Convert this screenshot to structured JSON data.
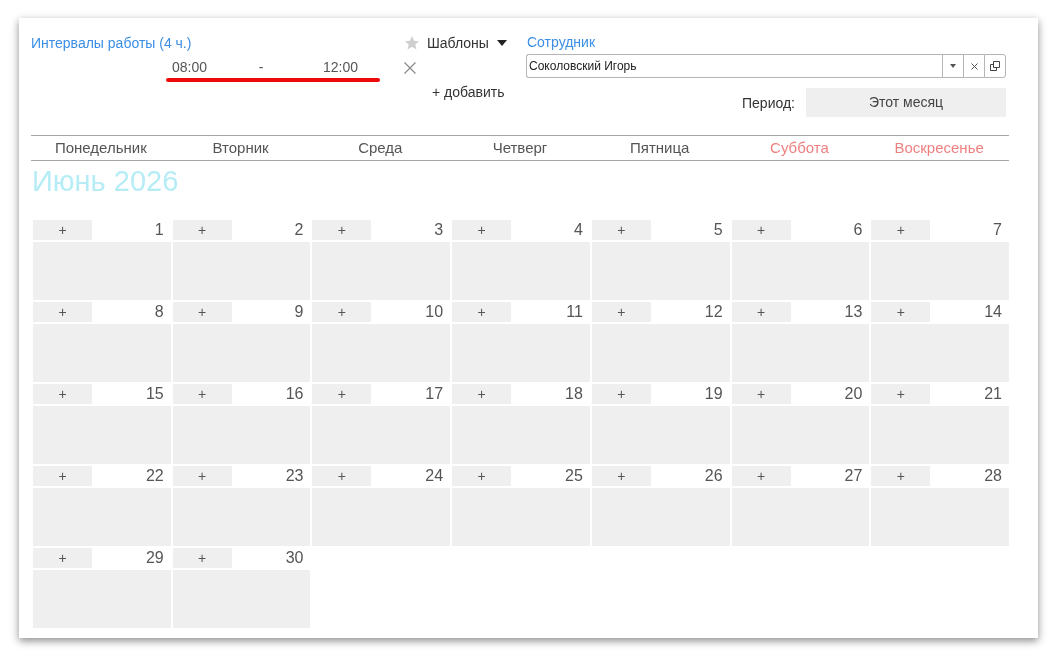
{
  "intervals": {
    "title": "Интервалы работы (4 ч.)",
    "items": [
      {
        "start": "08:00",
        "separator": "-",
        "end": "12:00",
        "highlighted": true
      }
    ],
    "add_label": "+ добавить"
  },
  "templates": {
    "label": "Шаблоны"
  },
  "employee": {
    "label": "Сотрудник",
    "value": "Соколовский Игорь"
  },
  "period": {
    "label": "Период:",
    "value": "Этот месяц"
  },
  "calendar": {
    "weekdays": [
      {
        "name": "Понедельник",
        "weekend": false
      },
      {
        "name": "Вторник",
        "weekend": false
      },
      {
        "name": "Среда",
        "weekend": false
      },
      {
        "name": "Четверг",
        "weekend": false
      },
      {
        "name": "Пятница",
        "weekend": false
      },
      {
        "name": "Суббота",
        "weekend": true
      },
      {
        "name": "Воскресенье",
        "weekend": true
      }
    ],
    "title": "Июнь 2026",
    "weeks": [
      [
        {
          "day": "1",
          "add": "+"
        },
        {
          "day": "2",
          "add": "+"
        },
        {
          "day": "3",
          "add": "+"
        },
        {
          "day": "4",
          "add": "+"
        },
        {
          "day": "5",
          "add": "+"
        },
        {
          "day": "6",
          "add": "+"
        },
        {
          "day": "7",
          "add": "+"
        }
      ],
      [
        {
          "day": "8",
          "add": "+"
        },
        {
          "day": "9",
          "add": "+"
        },
        {
          "day": "10",
          "add": "+"
        },
        {
          "day": "11",
          "add": "+"
        },
        {
          "day": "12",
          "add": "+"
        },
        {
          "day": "13",
          "add": "+"
        },
        {
          "day": "14",
          "add": "+"
        }
      ],
      [
        {
          "day": "15",
          "add": "+"
        },
        {
          "day": "16",
          "add": "+"
        },
        {
          "day": "17",
          "add": "+"
        },
        {
          "day": "18",
          "add": "+"
        },
        {
          "day": "19",
          "add": "+"
        },
        {
          "day": "20",
          "add": "+"
        },
        {
          "day": "21",
          "add": "+"
        }
      ],
      [
        {
          "day": "22",
          "add": "+"
        },
        {
          "day": "23",
          "add": "+"
        },
        {
          "day": "24",
          "add": "+"
        },
        {
          "day": "25",
          "add": "+"
        },
        {
          "day": "26",
          "add": "+"
        },
        {
          "day": "27",
          "add": "+"
        },
        {
          "day": "28",
          "add": "+"
        }
      ],
      [
        {
          "day": "29",
          "add": "+"
        },
        {
          "day": "30",
          "add": "+"
        }
      ]
    ]
  }
}
